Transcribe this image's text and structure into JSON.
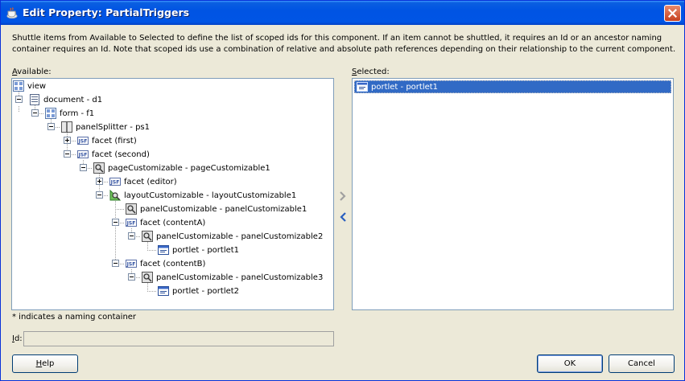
{
  "window": {
    "title": "Edit Property: PartialTriggers",
    "close_icon": "close-icon"
  },
  "description": "Shuttle items from Available to Selected to define the list of scoped ids for this component. If an item cannot be shuttled, it requires an Id or an ancestor naming container requires an Id. Note that scoped ids use a combination of relative and absolute path references depending on their relationship to the current component.",
  "available": {
    "label_prefix": "A",
    "label_rest": "vailable:",
    "tree": [
      {
        "label": "view",
        "icon": "view-icon"
      },
      {
        "label": "document - d1",
        "icon": "document-icon"
      },
      {
        "label": "form - f1",
        "icon": "form-icon"
      },
      {
        "label": "panelSplitter - ps1",
        "icon": "splitter-icon"
      },
      {
        "label": "facet (first)",
        "icon": "jsf-facet-icon"
      },
      {
        "label": "facet (second)",
        "icon": "jsf-facet-icon"
      },
      {
        "label": "pageCustomizable - pageCustomizable1",
        "icon": "customizable-icon"
      },
      {
        "label": "facet (editor)",
        "icon": "jsf-facet-icon"
      },
      {
        "label": "layoutCustomizable - layoutCustomizable1",
        "icon": "layout-customizable-icon"
      },
      {
        "label": "panelCustomizable - panelCustomizable1",
        "icon": "customizable-icon"
      },
      {
        "label": "facet (contentA)",
        "icon": "jsf-facet-icon"
      },
      {
        "label": "panelCustomizable - panelCustomizable2",
        "icon": "customizable-icon"
      },
      {
        "label": "portlet - portlet1",
        "icon": "portlet-icon"
      },
      {
        "label": "facet (contentB)",
        "icon": "jsf-facet-icon"
      },
      {
        "label": "panelCustomizable - panelCustomizable3",
        "icon": "customizable-icon"
      },
      {
        "label": "portlet - portlet2",
        "icon": "portlet-icon"
      }
    ]
  },
  "selected": {
    "label_prefix": "S",
    "label_rest": "elected:",
    "items": [
      {
        "label": "portlet - portlet1",
        "icon": "portlet-icon"
      }
    ]
  },
  "shuttle": {
    "move_right_icon": "chevron-right-icon",
    "move_left_icon": "chevron-left-icon"
  },
  "note": "* indicates a naming container",
  "id_field": {
    "label_prefix": "I",
    "label_rest": "d:",
    "value": ""
  },
  "buttons": {
    "help_prefix": "H",
    "help_rest": "elp",
    "ok": "OK",
    "cancel": "Cancel"
  }
}
